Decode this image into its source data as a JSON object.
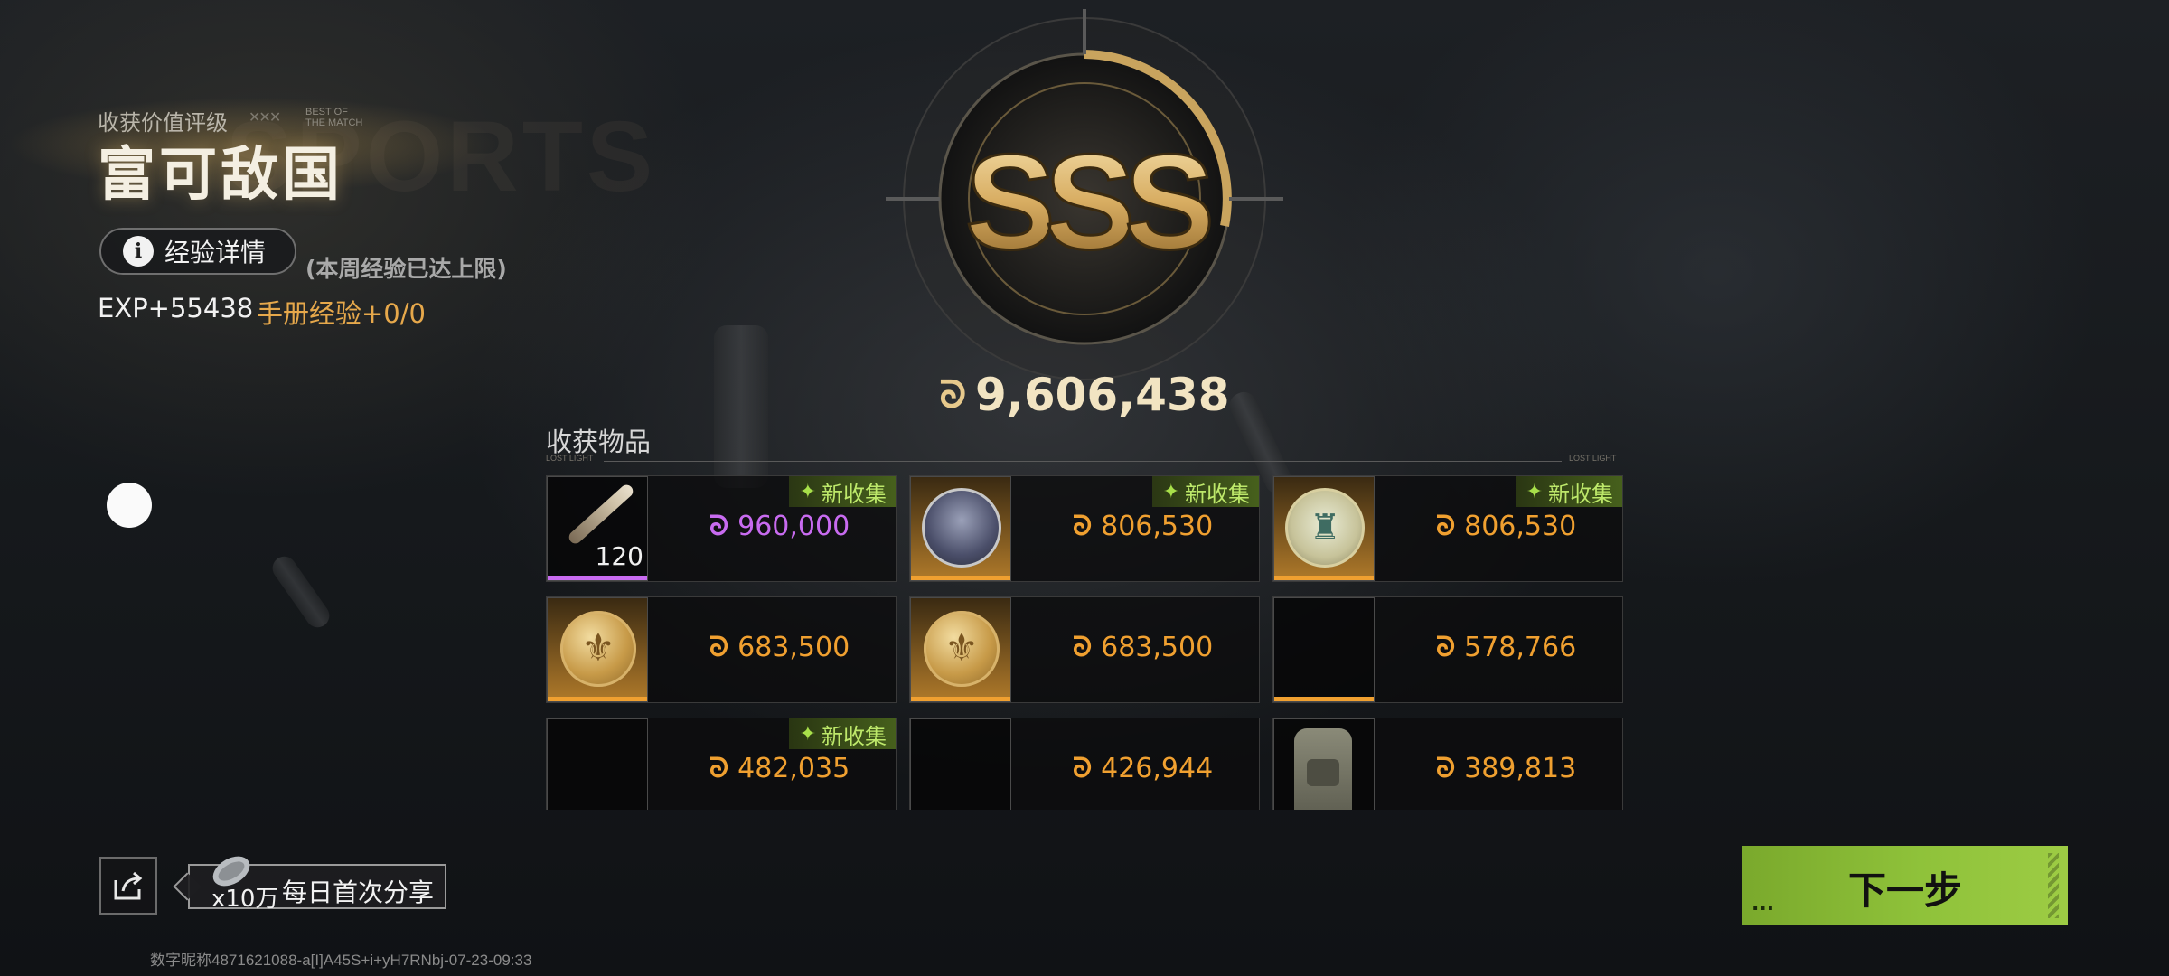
{
  "header": {
    "rating_label": "收获价值评级",
    "best_of_match": "BEST OF THE MATCH",
    "rating_title": "富可敌国",
    "watermark": "SPORTS",
    "exp_button_label": "经验详情",
    "exp_limit_note": "(本周经验已达上限)",
    "exp_value": "EXP+55438",
    "handbook_exp": "手册经验+0/0"
  },
  "emblem": {
    "grade": "SSS",
    "coin_glyph": "ᘐ",
    "total_value": "9,606,438"
  },
  "items": {
    "title": "收获物品",
    "subtitle_left": "LOST LIGHT",
    "subtitle_right": "LOST LIGHT",
    "new_badge": "新收集",
    "coin_glyph": "ᘐ",
    "rows": [
      {
        "price": "960,000",
        "price_color": "#c86bf0",
        "quantity": "120",
        "new": true,
        "icon": "bullet-icon",
        "rarity_color": "#c86bf0"
      },
      {
        "price": "806,530",
        "price_color": "#f0a030",
        "new": true,
        "icon": "portrait-icon",
        "rarity_color": "#f0a030"
      },
      {
        "price": "806,530",
        "price_color": "#f0a030",
        "new": true,
        "icon": "medal-icon",
        "rarity_color": "#f0a030"
      },
      {
        "price": "683,500",
        "price_color": "#f0a030",
        "new": false,
        "icon": "gold-coin-icon",
        "rarity_color": "#f0a030"
      },
      {
        "price": "683,500",
        "price_color": "#f0a030",
        "new": false,
        "icon": "gold-coin-icon",
        "rarity_color": "#f0a030"
      },
      {
        "price": "578,766",
        "price_color": "#f0a030",
        "new": false,
        "icon": "empty-icon",
        "rarity_color": "#f0a030"
      },
      {
        "price": "482,035",
        "price_color": "#f0a030",
        "new": true,
        "icon": "empty-icon",
        "rarity_color": "#f0a030"
      },
      {
        "price": "426,944",
        "price_color": "#f0a030",
        "new": false,
        "icon": "empty-icon",
        "rarity_color": "#f0a030"
      },
      {
        "price": "389,813",
        "price_color": "#f0a030",
        "new": false,
        "icon": "backpack-icon",
        "rarity_color": "#f0a030"
      }
    ]
  },
  "share": {
    "reward_qty": "x10万",
    "label": "每日首次分享"
  },
  "footer": {
    "id_text": "数字昵称4871621088-a[I]A45S+i+yH7RNbj-07-23-09:33"
  },
  "next_button": {
    "label": "下一步",
    "dots": "..."
  },
  "colors": {
    "accent_green": "#8fc23a",
    "orange": "#f0a030",
    "purple": "#c86bf0",
    "gold": "#e7c98c"
  }
}
